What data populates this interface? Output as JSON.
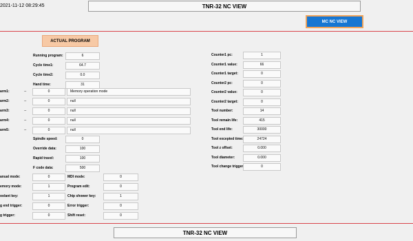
{
  "header": {
    "datetime": "2021-11-12 08:29:45",
    "title": "TNR-32 NC VIEW",
    "mc_button": "MC NC VIEW"
  },
  "actual_program_label": "ACTUAL PROGRAM",
  "program": [
    {
      "label": "Running program:",
      "value": "6"
    },
    {
      "label": "Cycle time1:",
      "value": "64.7"
    },
    {
      "label": "Cycle time2:",
      "value": "0.0"
    },
    {
      "label": "Hand time:",
      "value": "31"
    }
  ],
  "alarms": [
    {
      "label": "arm1:",
      "dash": "--",
      "code": "0",
      "message": "Memory operation mode"
    },
    {
      "label": "arm2:",
      "dash": "--",
      "code": "0",
      "message": "null"
    },
    {
      "label": "arm3:",
      "dash": "--",
      "code": "0",
      "message": "null"
    },
    {
      "label": "arm4:",
      "dash": "--",
      "code": "0",
      "message": "null"
    },
    {
      "label": "arm5:",
      "dash": "--",
      "code": "0",
      "message": "null"
    }
  ],
  "spindle": [
    {
      "label": "Spindle speed:",
      "value": "0"
    },
    {
      "label": "Override data:",
      "value": "100"
    },
    {
      "label": "Rapid travel:",
      "value": "100"
    },
    {
      "label": "F code data:",
      "value": "500"
    }
  ],
  "modes_left": [
    {
      "label": "anual mode:",
      "value": "0"
    },
    {
      "label": "emory mode:",
      "value": "1"
    },
    {
      "label": "oolant key:",
      "value": "1"
    },
    {
      "label": "g end trigger:",
      "value": "0"
    },
    {
      "label": "g trigger:",
      "value": "0"
    }
  ],
  "modes_right": [
    {
      "label": "MDI mode:",
      "value": "0"
    },
    {
      "label": "Program edit:",
      "value": "0"
    },
    {
      "label": "Chip shower key:",
      "value": "1"
    },
    {
      "label": "Error trigger:",
      "value": "0"
    },
    {
      "label": "Shift reset:",
      "value": "0"
    }
  ],
  "counters": [
    {
      "label": "Counter1 pc:",
      "value": "1"
    },
    {
      "label": "Counter1 value:",
      "value": "66"
    },
    {
      "label": "Counter1 target:",
      "value": "0"
    },
    {
      "label": "Counter2 pc:",
      "value": "0"
    },
    {
      "label": "Counter2 value:",
      "value": "0"
    },
    {
      "label": "Counter2 target:",
      "value": "0"
    },
    {
      "label": "Tool number:",
      "value": "14"
    },
    {
      "label": "Tool remain life:",
      "value": "415"
    },
    {
      "label": "Tool end life:",
      "value": "30000"
    },
    {
      "label": "Tool excepted time:",
      "value": "24724"
    },
    {
      "label": "Tool z offset:",
      "value": "0.000"
    },
    {
      "label": "Tool diameter:",
      "value": "0.000"
    },
    {
      "label": "Tool change trigger:",
      "value": "0"
    }
  ],
  "footer": {
    "title": "TNR-32 NC VIEW"
  },
  "colors": {
    "accent_line": "#d9434a",
    "button_blue": "#1676d2",
    "button_border": "#f0a35a",
    "actual_bg": "#f7c9a5"
  }
}
